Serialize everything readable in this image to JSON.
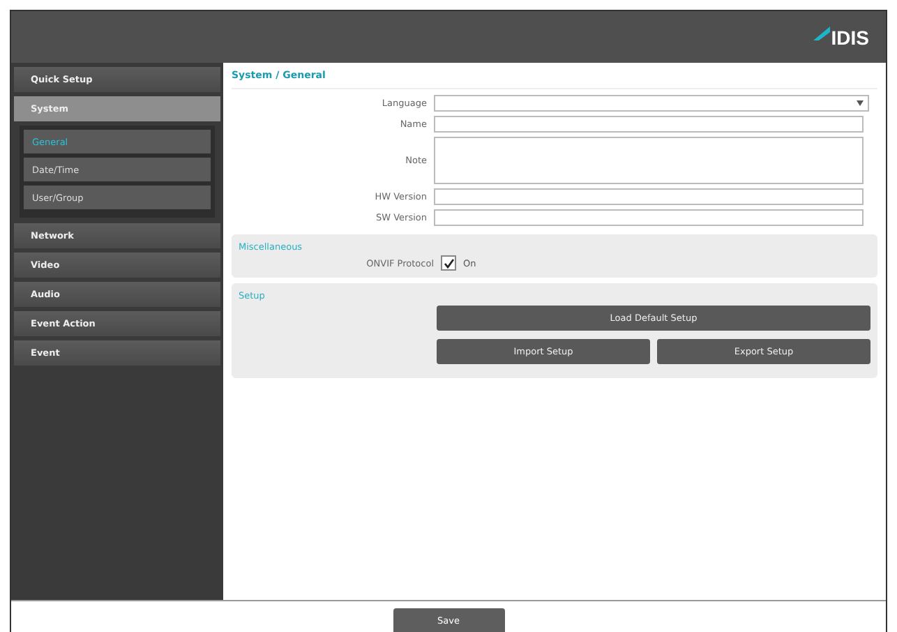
{
  "logo": "IDIS",
  "sidebar": {
    "items": [
      {
        "label": "Quick Setup",
        "expanded": false
      },
      {
        "label": "System",
        "expanded": true,
        "children": [
          {
            "label": "General",
            "selected": true
          },
          {
            "label": "Date/Time",
            "selected": false
          },
          {
            "label": "User/Group",
            "selected": false
          }
        ]
      },
      {
        "label": "Network",
        "expanded": false
      },
      {
        "label": "Video",
        "expanded": false
      },
      {
        "label": "Audio",
        "expanded": false
      },
      {
        "label": "Event Action",
        "expanded": false
      },
      {
        "label": "Event",
        "expanded": false
      }
    ]
  },
  "breadcrumb": "System / General",
  "fields": [
    {
      "label": "Language",
      "kind": "select"
    },
    {
      "label": "Name",
      "kind": "text"
    },
    {
      "label": "Note",
      "kind": "textarea"
    },
    {
      "label": "HW Version",
      "kind": "text"
    },
    {
      "label": "SW Version",
      "kind": "text"
    }
  ],
  "miscellaneous": {
    "title": "Miscellaneous",
    "label": "ONVIF Protocol",
    "option": "On",
    "checked": true
  },
  "setup": {
    "title": "Setup",
    "buttons": [
      "Load Default Setup",
      "Import Setup",
      "Export Setup"
    ]
  },
  "save_button": "Save"
}
